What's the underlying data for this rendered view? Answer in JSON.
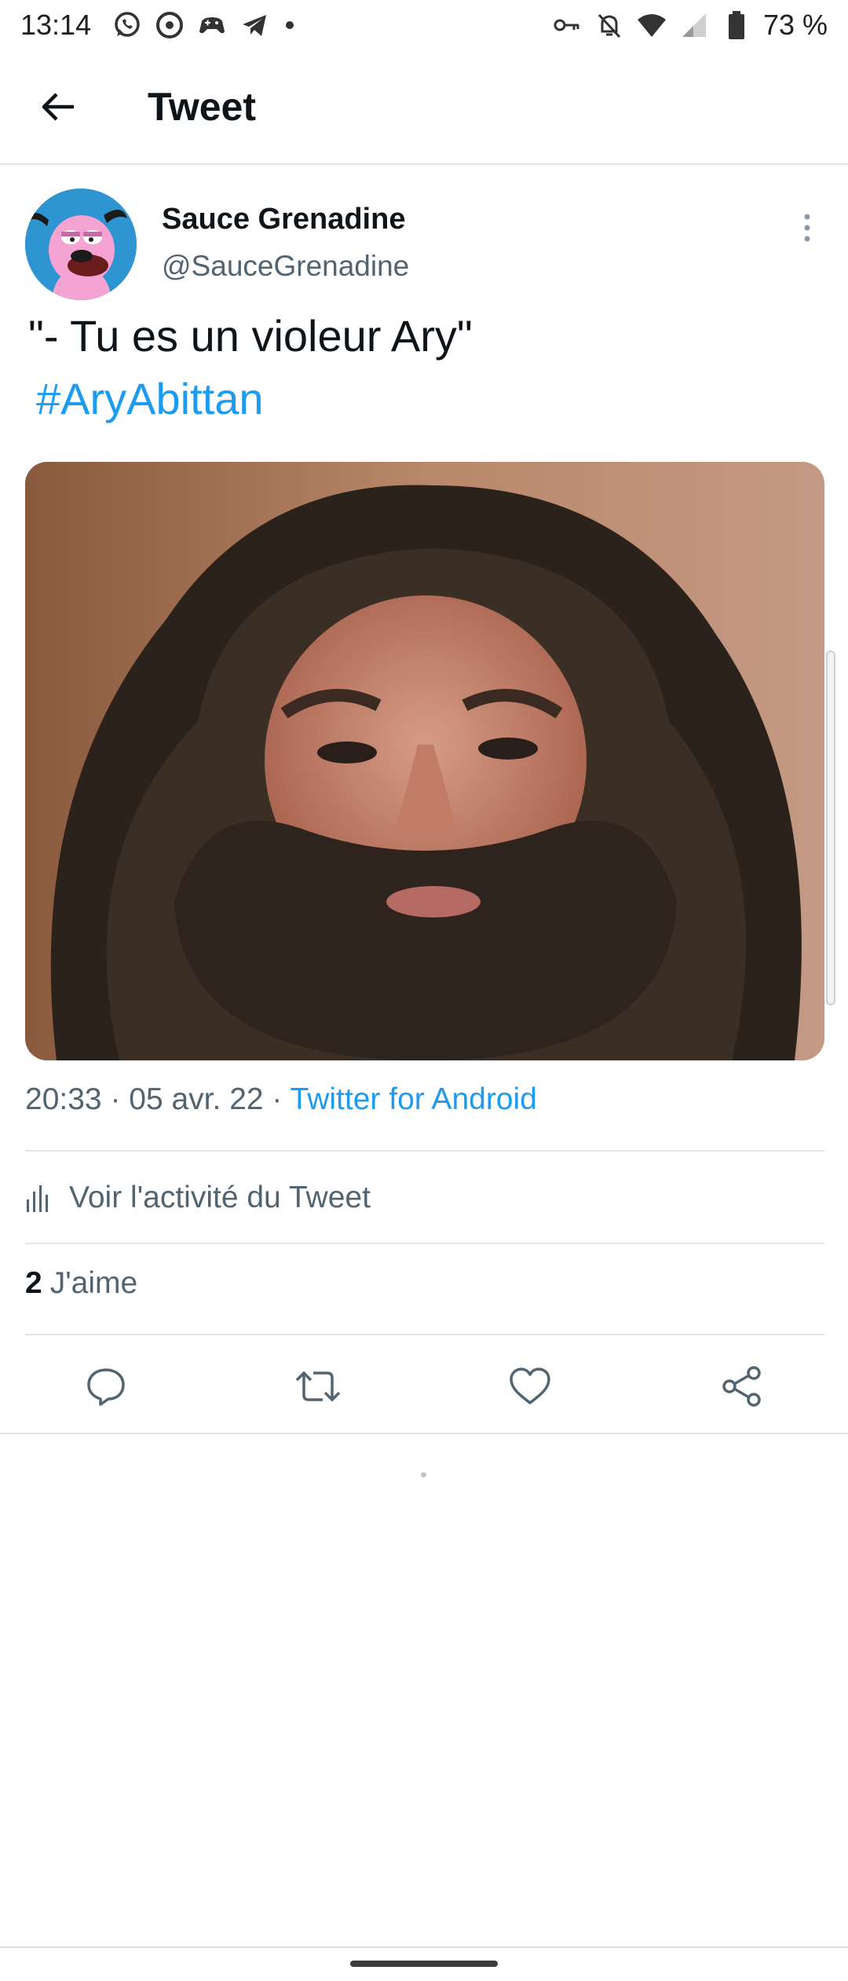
{
  "status_bar": {
    "time": "13:14",
    "battery_percent": "73 %",
    "left_icons": [
      "whatsapp-icon",
      "app-circle-icon",
      "game-controller-icon",
      "telegram-icon",
      "more-dot-icon"
    ],
    "right_icons": [
      "vpn-key-icon",
      "notifications-off-icon",
      "wifi-icon",
      "signal-icon",
      "battery-icon"
    ]
  },
  "header": {
    "back_icon": "arrow-left-icon",
    "title": "Tweet"
  },
  "tweet": {
    "author_name": "Sauce Grenadine",
    "author_handle": "@SauceGrenadine",
    "text": "\"- Tu es un violeur Ary\"",
    "hashtag": "#AryAbittan",
    "time": "20:33",
    "date": "05 avr. 22",
    "source": "Twitter for Android",
    "separator": " · ",
    "activity_label": "Voir l'activité du Tweet",
    "likes_count": "2",
    "likes_label": "J'aime"
  },
  "actions": {
    "icons": [
      "reply-icon",
      "retweet-icon",
      "like-icon",
      "share-icon"
    ]
  },
  "colors": {
    "accent": "#1d9bf0",
    "secondary_text": "#536471",
    "primary_text": "#0f1419",
    "divider": "#e6e6e6"
  }
}
